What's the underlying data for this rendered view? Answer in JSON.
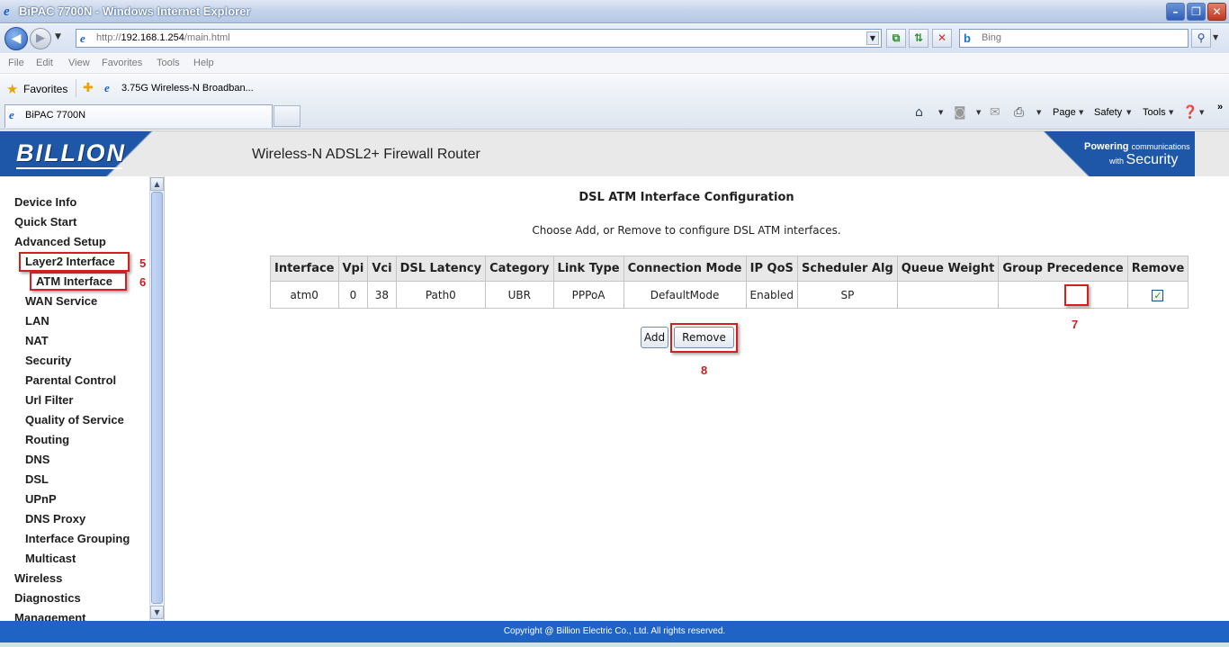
{
  "window": {
    "title": "BiPAC 7700N - Windows Internet Explorer",
    "min_glyph": "–",
    "max_glyph": "❐",
    "close_glyph": "✕"
  },
  "address_bar": {
    "url_prefix": "http://",
    "url_host": "192.168.1.254",
    "url_path": "/main.html",
    "search_placeholder": "Bing"
  },
  "menu": [
    "File",
    "Edit",
    "View",
    "Favorites",
    "Tools",
    "Help"
  ],
  "favorites_bar": {
    "label": "Favorites",
    "link": "3.75G Wireless-N Broadban..."
  },
  "tab": {
    "title": "BiPAC 7700N"
  },
  "command_bar": {
    "page": "Page",
    "safety": "Safety",
    "tools": "Tools"
  },
  "banner": {
    "logo": "BILLION",
    "title": "Wireless-N ADSL2+ Firewall Router",
    "slogan_line1_bold": "Powering",
    "slogan_line1_small": "communications",
    "slogan_line2_with": "with",
    "slogan_line2_big": "Security"
  },
  "sidebar": {
    "items": [
      "Device Info",
      "Quick Start",
      "Advanced Setup",
      "Layer2 Interface",
      "ATM Interface",
      "WAN Service",
      "LAN",
      "NAT",
      "Security",
      "Parental Control",
      "Url Filter",
      "Quality of Service",
      "Routing",
      "DNS",
      "DSL",
      "UPnP",
      "DNS Proxy",
      "Interface Grouping",
      "Multicast",
      "Wireless",
      "Diagnostics",
      "Management"
    ]
  },
  "main": {
    "title": "DSL ATM Interface Configuration",
    "subtitle": "Choose Add, or Remove to configure DSL ATM interfaces.",
    "table": {
      "headers": [
        "Interface",
        "Vpi",
        "Vci",
        "DSL Latency",
        "Category",
        "Link Type",
        "Connection Mode",
        "IP QoS",
        "Scheduler Alg",
        "Queue Weight",
        "Group Precedence",
        "Remove"
      ],
      "rows": [
        [
          "atm0",
          "0",
          "38",
          "Path0",
          "UBR",
          "PPPoA",
          "DefaultMode",
          "Enabled",
          "SP",
          "",
          ""
        ]
      ],
      "remove_checked": true
    },
    "add_label": "Add",
    "remove_label": "Remove"
  },
  "annotations": {
    "step5": "5",
    "step6": "6",
    "step7": "7",
    "step8": "8"
  },
  "footer": {
    "copyright": "Copyright @ Billion Electric Co., Ltd. All rights reserved."
  },
  "colors": {
    "brand_blue": "#1f57a8",
    "footer_blue": "#1f63c4",
    "annotation_red": "#d21f1f"
  }
}
